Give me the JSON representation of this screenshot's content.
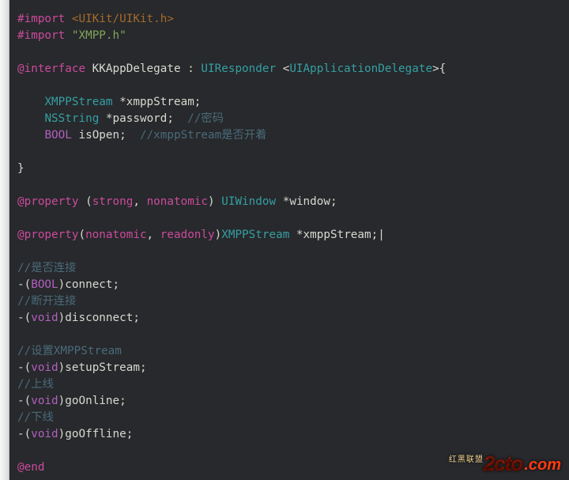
{
  "lines": [
    {
      "segments": [
        {
          "t": "#import",
          "c": "mg"
        },
        {
          "t": " ",
          "c": "def"
        },
        {
          "t": "<UIKit/UIKit.h>",
          "c": "an"
        }
      ]
    },
    {
      "segments": [
        {
          "t": "#import",
          "c": "mg"
        },
        {
          "t": " ",
          "c": "def"
        },
        {
          "t": "\"XMPP.h\"",
          "c": "st"
        }
      ]
    },
    {
      "segments": [
        {
          "t": " ",
          "c": "def"
        }
      ]
    },
    {
      "segments": [
        {
          "t": "@interface",
          "c": "mg"
        },
        {
          "t": " KKAppDelegate : ",
          "c": "def"
        },
        {
          "t": "UIResponder",
          "c": "tl"
        },
        {
          "t": " <",
          "c": "def"
        },
        {
          "t": "UIApplicationDelegate",
          "c": "tl"
        },
        {
          "t": ">{",
          "c": "def"
        }
      ]
    },
    {
      "segments": [
        {
          "t": " ",
          "c": "def"
        }
      ]
    },
    {
      "segments": [
        {
          "t": "    ",
          "c": "def"
        },
        {
          "t": "XMPPStream",
          "c": "tl"
        },
        {
          "t": " *xmppStream;",
          "c": "def"
        }
      ]
    },
    {
      "segments": [
        {
          "t": "    ",
          "c": "def"
        },
        {
          "t": "NSString",
          "c": "tl"
        },
        {
          "t": " *password;  ",
          "c": "def"
        },
        {
          "t": "//密码",
          "c": "cm"
        }
      ]
    },
    {
      "segments": [
        {
          "t": "    ",
          "c": "def"
        },
        {
          "t": "BOOL",
          "c": "pr"
        },
        {
          "t": " isOpen;  ",
          "c": "def"
        },
        {
          "t": "//xmppStream是否开着",
          "c": "cm"
        }
      ]
    },
    {
      "segments": [
        {
          "t": " ",
          "c": "def"
        }
      ]
    },
    {
      "segments": [
        {
          "t": "}",
          "c": "def"
        }
      ]
    },
    {
      "segments": [
        {
          "t": " ",
          "c": "def"
        }
      ]
    },
    {
      "segments": [
        {
          "t": "@property",
          "c": "mg"
        },
        {
          "t": " (",
          "c": "def"
        },
        {
          "t": "strong",
          "c": "mg"
        },
        {
          "t": ", ",
          "c": "def"
        },
        {
          "t": "nonatomic",
          "c": "mg"
        },
        {
          "t": ") ",
          "c": "def"
        },
        {
          "t": "UIWindow",
          "c": "tl"
        },
        {
          "t": " *window;",
          "c": "def"
        }
      ]
    },
    {
      "segments": [
        {
          "t": " ",
          "c": "def"
        }
      ]
    },
    {
      "segments": [
        {
          "t": "@property",
          "c": "mg"
        },
        {
          "t": "(",
          "c": "def"
        },
        {
          "t": "nonatomic",
          "c": "mg"
        },
        {
          "t": ", ",
          "c": "def"
        },
        {
          "t": "readonly",
          "c": "mg"
        },
        {
          "t": ")",
          "c": "def"
        },
        {
          "t": "XMPPStream",
          "c": "tl"
        },
        {
          "t": " *xmppStream;",
          "c": "def"
        },
        {
          "t": "|",
          "c": "cursor"
        }
      ]
    },
    {
      "segments": [
        {
          "t": " ",
          "c": "def"
        }
      ]
    },
    {
      "segments": [
        {
          "t": "//是否连接",
          "c": "cm"
        }
      ]
    },
    {
      "segments": [
        {
          "t": "-(",
          "c": "def"
        },
        {
          "t": "BOOL",
          "c": "pr"
        },
        {
          "t": ")connect;",
          "c": "def"
        }
      ]
    },
    {
      "segments": [
        {
          "t": "//断开连接",
          "c": "cm"
        }
      ]
    },
    {
      "segments": [
        {
          "t": "-(",
          "c": "def"
        },
        {
          "t": "void",
          "c": "pr"
        },
        {
          "t": ")disconnect;",
          "c": "def"
        }
      ]
    },
    {
      "segments": [
        {
          "t": " ",
          "c": "def"
        }
      ]
    },
    {
      "segments": [
        {
          "t": "//设置XMPPStream",
          "c": "cm"
        }
      ]
    },
    {
      "segments": [
        {
          "t": "-(",
          "c": "def"
        },
        {
          "t": "void",
          "c": "pr"
        },
        {
          "t": ")setupStream;",
          "c": "def"
        }
      ]
    },
    {
      "segments": [
        {
          "t": "//上线",
          "c": "cm"
        }
      ]
    },
    {
      "segments": [
        {
          "t": "-(",
          "c": "def"
        },
        {
          "t": "void",
          "c": "pr"
        },
        {
          "t": ")goOnline;",
          "c": "def"
        }
      ]
    },
    {
      "segments": [
        {
          "t": "//下线",
          "c": "cm"
        }
      ]
    },
    {
      "segments": [
        {
          "t": "-(",
          "c": "def"
        },
        {
          "t": "void",
          "c": "pr"
        },
        {
          "t": ")goOffline;",
          "c": "def"
        }
      ]
    },
    {
      "segments": [
        {
          "t": " ",
          "c": "def"
        }
      ]
    },
    {
      "segments": [
        {
          "t": "@end",
          "c": "mg"
        }
      ]
    }
  ],
  "watermark": {
    "main": "2cto",
    "suffix": ".com",
    "cn": "红黑联盟"
  }
}
